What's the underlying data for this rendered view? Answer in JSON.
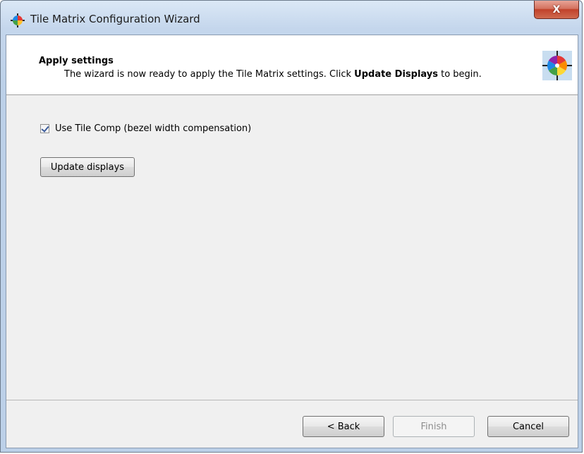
{
  "window": {
    "title": "Tile Matrix Configuration Wizard",
    "close_label": "X"
  },
  "header": {
    "title": "Apply settings",
    "desc_prefix": "The wizard is now ready to apply the Tile Matrix settings. Click ",
    "desc_bold": "Update Displays",
    "desc_suffix": " to begin."
  },
  "options": {
    "tile_comp_label": "Use Tile Comp (bezel width compensation)",
    "tile_comp_checked": true
  },
  "actions": {
    "update_label": "Update displays"
  },
  "footer": {
    "back_label": "< Back",
    "finish_label": "Finish",
    "cancel_label": "Cancel"
  },
  "icons": {
    "app": "color-wheel-icon",
    "header": "color-wheel-crosshair-icon"
  }
}
